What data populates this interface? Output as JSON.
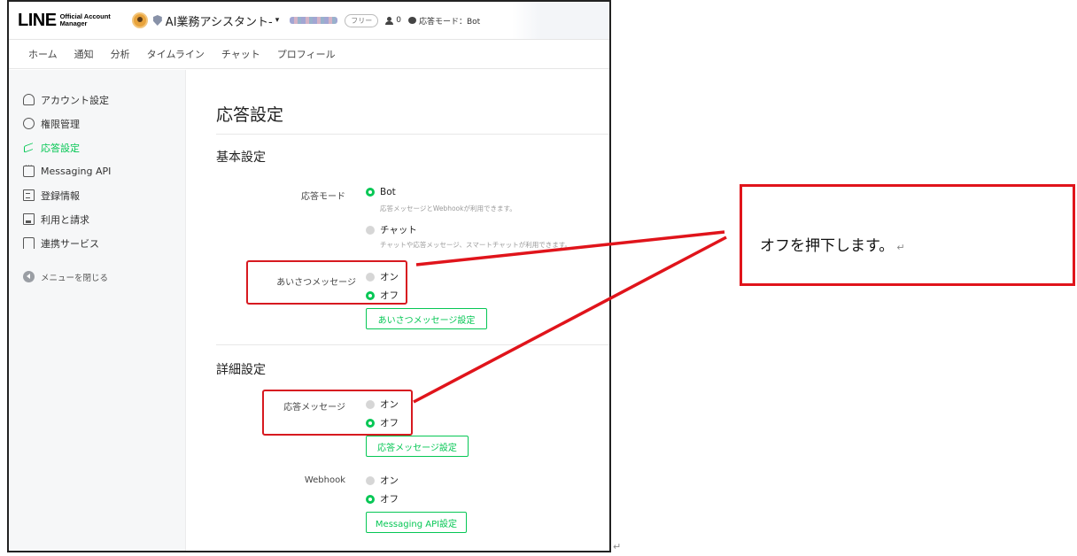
{
  "header": {
    "logo_main": "LINE",
    "logo_sub_1": "Official Account",
    "logo_sub_2": "Manager",
    "account_name": "AI業務アシスタント-",
    "caret": "▾",
    "plan_badge": "フリー",
    "friend_count": "0",
    "response_mode": "応答モード：Bot"
  },
  "nav": {
    "tabs": [
      "ホーム",
      "通知",
      "分析",
      "タイムライン",
      "チャット",
      "プロフィール"
    ]
  },
  "sidebar": {
    "items": [
      {
        "label": "アカウント設定",
        "icon": "person-icon"
      },
      {
        "label": "権限管理",
        "icon": "group-icon"
      },
      {
        "label": "応答設定",
        "icon": "reply-icon"
      },
      {
        "label": "Messaging API",
        "icon": "message-icon"
      },
      {
        "label": "登録情報",
        "icon": "document-icon"
      },
      {
        "label": "利用と請求",
        "icon": "bill-icon"
      },
      {
        "label": "連携サービス",
        "icon": "link-icon"
      }
    ],
    "collapse_label": "メニューを閉じる"
  },
  "main": {
    "page_title": "応答設定",
    "basic": {
      "title": "基本設定",
      "mode_label": "応答モード",
      "mode_bot": "Bot",
      "mode_bot_desc": "応答メッセージとWebhookが利用できます。",
      "mode_chat": "チャット",
      "mode_chat_desc": "チャットや応答メッセージ、スマートチャットが利用できます。",
      "greeting_label": "あいさつメッセージ",
      "on": "オン",
      "off": "オフ",
      "greeting_button": "あいさつメッセージ設定"
    },
    "detail": {
      "title": "詳細設定",
      "auto_reply_label": "応答メッセージ",
      "on": "オン",
      "off": "オフ",
      "auto_reply_button": "応答メッセージ設定",
      "webhook_label": "Webhook",
      "webhook_on": "オン",
      "webhook_off": "オフ",
      "webhook_button": "Messaging API設定"
    }
  },
  "callout": {
    "text": "オフを押下します。",
    "return_mark": "↵"
  },
  "colors": {
    "accent": "#06c755",
    "highlight": "#d71920"
  }
}
